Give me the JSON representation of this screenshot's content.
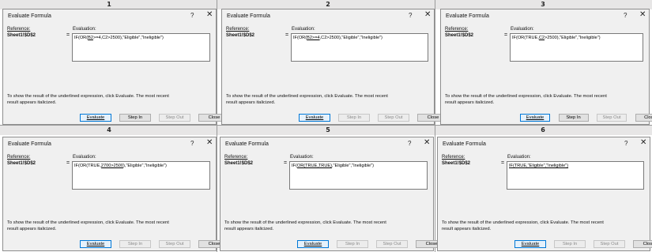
{
  "panel_numbers": [
    "1",
    "2",
    "3",
    "4",
    "5",
    "6"
  ],
  "dialog": {
    "title": "Evaluate Formula",
    "help": "?",
    "close_glyph": "✕",
    "reference_label": "Reference:",
    "evaluation_label": "Evaluation:",
    "reference_value": "Sheet1!$D$2",
    "equals": "=",
    "info_line1": "To show the result of the underlined expression, click Evaluate.  The most recent",
    "info_line2": "result appears italicized.",
    "buttons": {
      "evaluate": "Evaluate",
      "step_in": "Step In",
      "step_out": "Step Out",
      "close": "Close"
    }
  },
  "panels": [
    {
      "before": "IF(OR(",
      "underlined": "B2",
      "after": ">=4,C2>2500),\"Eligible\",\"Ineligible\")",
      "step_in_enabled": true
    },
    {
      "before": "IF(OR(",
      "underlined": "B2>=4",
      "after": ",C2>2500),\"Eligible\",\"Ineligible\")",
      "step_in_enabled": false
    },
    {
      "before": "IF(OR(TRUE,",
      "underlined": "C2",
      "after": ">2500),\"Eligible\",\"Ineligible\")",
      "step_in_enabled": true
    },
    {
      "before": "IF(OR(TRUE,",
      "underlined": "2700>2500",
      "after": "),\"Eligible\",\"Ineligible\")",
      "step_in_enabled": false
    },
    {
      "before": "IF(",
      "underlined": "OR(TRUE,TRUE)",
      "after": ",\"Eligible\",\"Ineligible\")",
      "step_in_enabled": false
    },
    {
      "before": "",
      "underlined": "IF(TRUE,\"Eligible\",\"Ineligible\")",
      "after": "",
      "step_in_enabled": false
    }
  ]
}
